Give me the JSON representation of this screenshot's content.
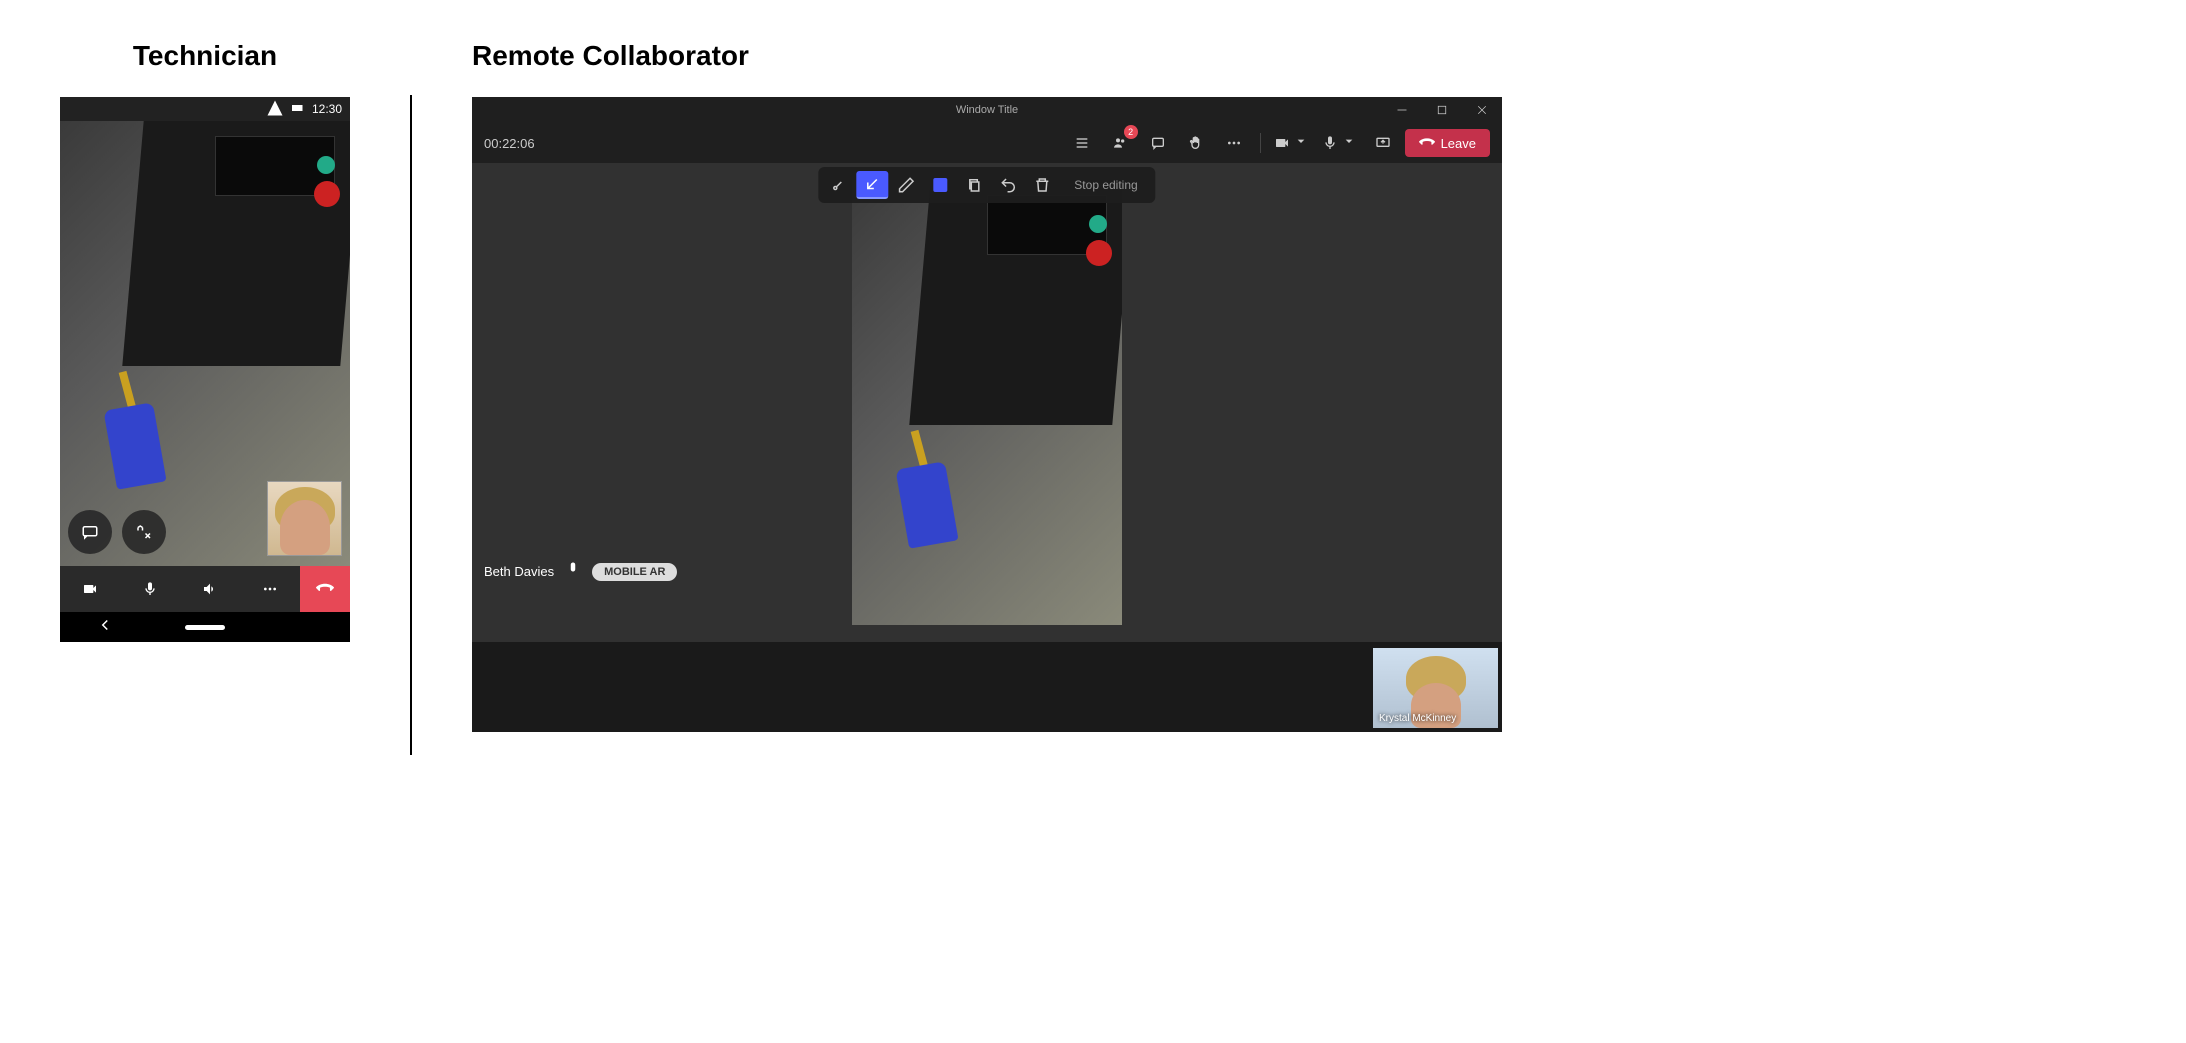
{
  "labels": {
    "technician": "Technician",
    "collaborator": "Remote Collaborator"
  },
  "phone": {
    "time": "12:30"
  },
  "desktop": {
    "window_title": "Window Title",
    "call_duration": "00:22:06",
    "participants_badge": "2",
    "leave_label": "Leave",
    "caller_name": "Beth Davies",
    "mobile_ar_label": "MOBILE AR",
    "stop_editing_label": "Stop editing",
    "pip_name": "Krystal McKinney"
  }
}
